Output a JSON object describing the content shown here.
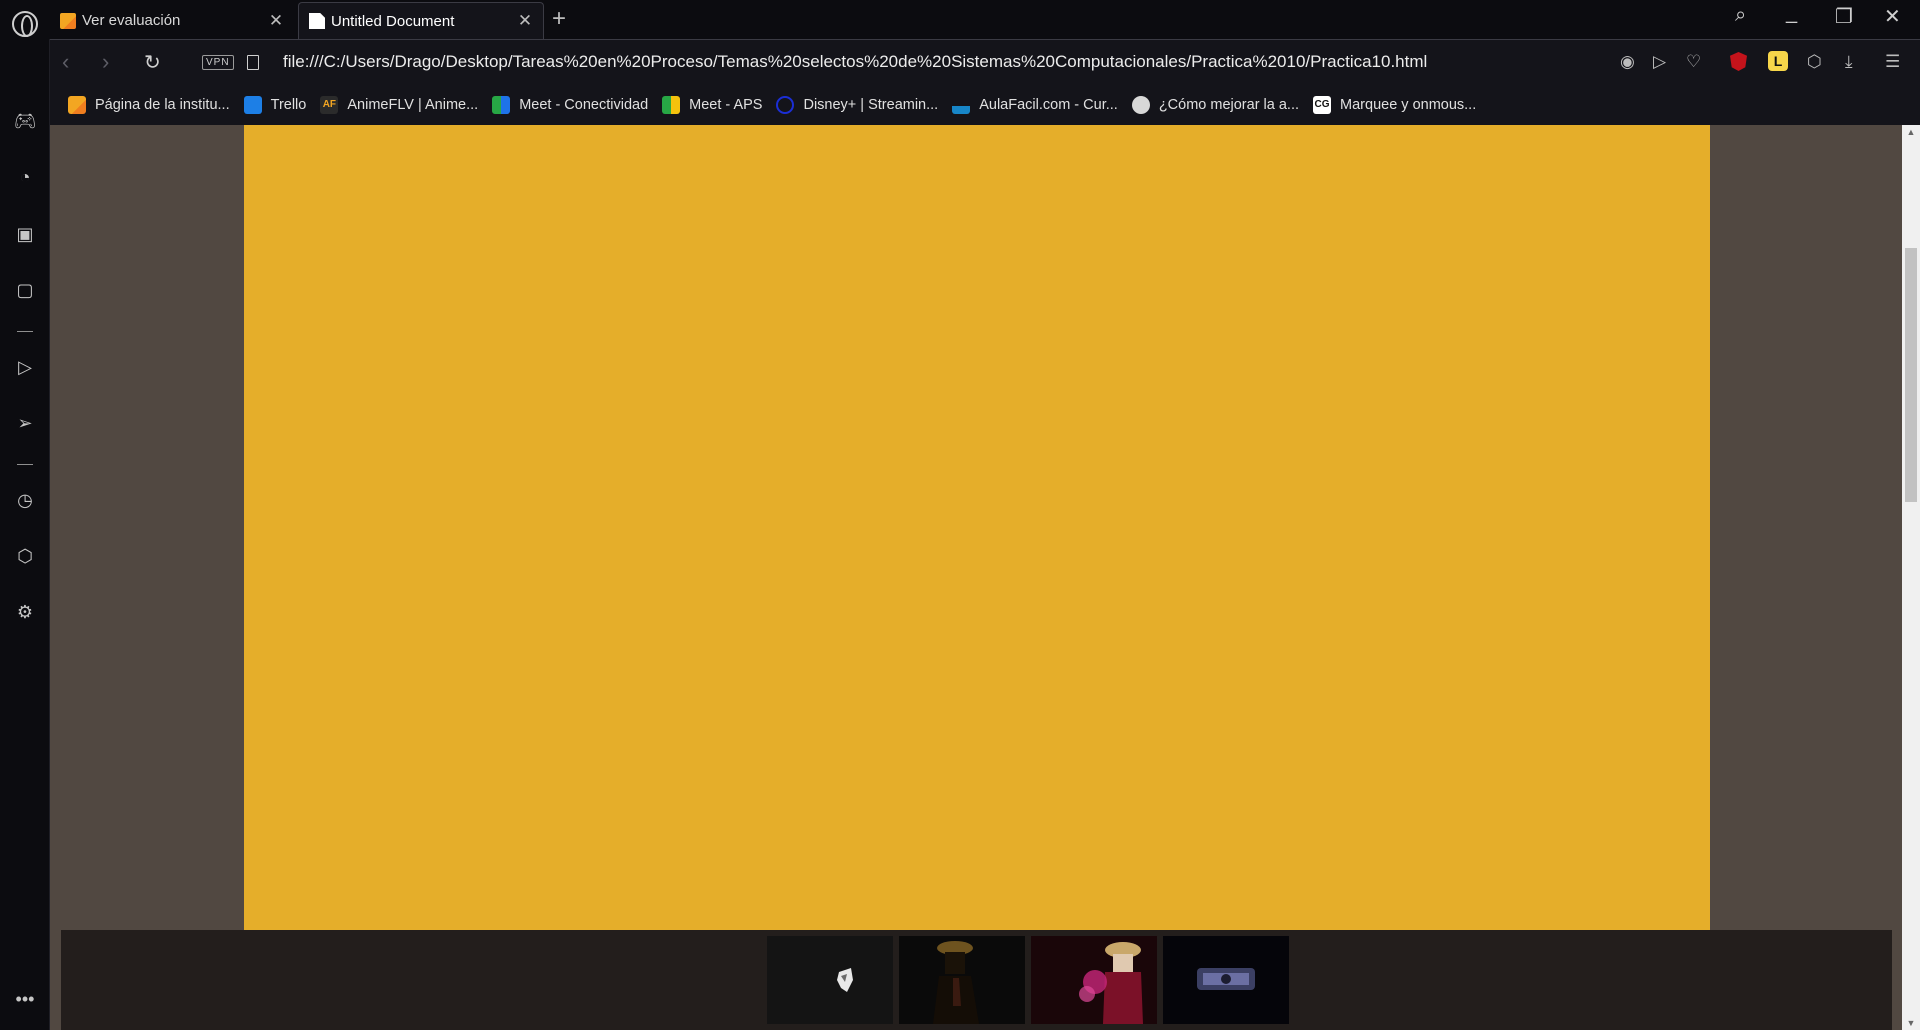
{
  "tabs": [
    {
      "title": "Ver evaluación",
      "active": false
    },
    {
      "title": "Untitled Document",
      "active": true
    }
  ],
  "address_bar": {
    "vpn_label": "VPN",
    "url": "file:///C:/Users/Drago/Desktop/Tareas%20en%20Proceso/Temas%20selectos%20de%20Sistemas%20Computacionales/Practica%2010/Practica10.html"
  },
  "bookmarks": [
    {
      "label": "Página de la institu...",
      "icon": "pencil-favicon",
      "color": "#f3a622"
    },
    {
      "label": "Trello",
      "icon": "trello-icon",
      "color": "#1d7fe6"
    },
    {
      "label": "AnimeFLV | Anime...",
      "icon": "animeflv-icon",
      "icon_text": "AF",
      "color": "#2b2b2b"
    },
    {
      "label": "Meet - Conectividad",
      "icon": "meet-icon",
      "color": "#27a745"
    },
    {
      "label": "Meet - APS",
      "icon": "meet-icon",
      "color": "#27a745"
    },
    {
      "label": "Disney+ | Streamin...",
      "icon": "disney-icon",
      "color": "#1b2ed6"
    },
    {
      "label": "AulaFacil.com - Cur...",
      "icon": "aulafacil-icon",
      "color": "#1786c8"
    },
    {
      "label": "¿Cómo mejorar la a...",
      "icon": "globe-icon",
      "color": "#d8d8d8"
    },
    {
      "label": "Marquee y onmous...",
      "icon": "cg-icon",
      "icon_text": "CG",
      "color": "#ffffff"
    }
  ],
  "page": {
    "background": "#514841",
    "content_box_color": "#e5ae2a",
    "gallery_background": "#231e1c"
  },
  "gallery": [
    {
      "name": "gallery-image-1"
    },
    {
      "name": "gallery-image-2"
    },
    {
      "name": "gallery-image-3"
    },
    {
      "name": "gallery-image-4"
    }
  ]
}
